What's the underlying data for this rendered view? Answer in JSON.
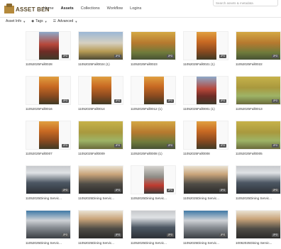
{
  "app": {
    "logo_text": "ASSET BEN",
    "search_placeholder": "Search assets & metadata"
  },
  "nav": {
    "items": [
      {
        "label": "Home",
        "active": false
      },
      {
        "label": "Assets",
        "active": true
      },
      {
        "label": "Collections",
        "active": false
      },
      {
        "label": "Workflow",
        "active": false
      },
      {
        "label": "Logins",
        "active": false
      }
    ]
  },
  "filters": {
    "asset_info": "Asset Info",
    "tags": "Tags",
    "advanced": "Advanced"
  },
  "assets": [
    {
      "caption": "11052025Fall0028",
      "badge": "JPG",
      "scene": "tower"
    },
    {
      "caption": "11052025Fall0024 (1)",
      "badge": "JPG",
      "scene": "tempWide"
    },
    {
      "caption": "11052025Fall0023",
      "badge": "JPG",
      "scene": "autumnWide"
    },
    {
      "caption": "11052025Fall0021 (1)",
      "badge": "JPG",
      "scene": "tree"
    },
    {
      "caption": "11052025Fall0022",
      "badge": "JPG",
      "scene": "autumnWide"
    },
    {
      "caption": "11052025Fall0016",
      "badge": "JPG",
      "scene": "tree"
    },
    {
      "caption": "11052025Fall0014",
      "badge": "JPG",
      "scene": "tree"
    },
    {
      "caption": "11052025Fall0012 (1)",
      "badge": "JPG",
      "scene": "tree"
    },
    {
      "caption": "11052025Fall0001 (1)",
      "badge": "JPG",
      "scene": "tower"
    },
    {
      "caption": "11052025Fall0013",
      "badge": "JPG",
      "scene": "park"
    },
    {
      "caption": "11052025Fall0007",
      "badge": "JPG",
      "scene": "tree"
    },
    {
      "caption": "11052025Fall0009",
      "badge": "JPG",
      "scene": "park"
    },
    {
      "caption": "11052025Fall0008 (1)",
      "badge": "JPG",
      "scene": "autumnWide"
    },
    {
      "caption": "11052025Fall0008",
      "badge": "JPG",
      "scene": "tree"
    },
    {
      "caption": "11052025Fall0005",
      "badge": "JPG",
      "scene": "park"
    },
    {
      "caption": "11052025Dining Servic...",
      "badge": "JPG",
      "scene": "dining"
    },
    {
      "caption": "11052025Dining Servic...",
      "badge": "JPG",
      "scene": "dining2"
    },
    {
      "caption": "11052025Dining Servic...",
      "badge": "JPG",
      "scene": "shelf"
    },
    {
      "caption": "11052025Dining Servic...",
      "badge": "JPG",
      "scene": "dining2"
    },
    {
      "caption": "11052025Dining Servic...",
      "badge": "JPG",
      "scene": "dining"
    },
    {
      "caption": "11052025Dining Servic...",
      "badge": "JPG",
      "scene": "screens"
    },
    {
      "caption": "11052025Dining Servic...",
      "badge": "JPG",
      "scene": "dining2"
    },
    {
      "caption": "11052025Dining Servic...",
      "badge": "JPG",
      "scene": "dining"
    },
    {
      "caption": "11052025Dining Servic...",
      "badge": "JPG",
      "scene": "screens"
    },
    {
      "caption": "10062025Dining Servic...",
      "badge": "JPG",
      "scene": "dining2"
    }
  ]
}
